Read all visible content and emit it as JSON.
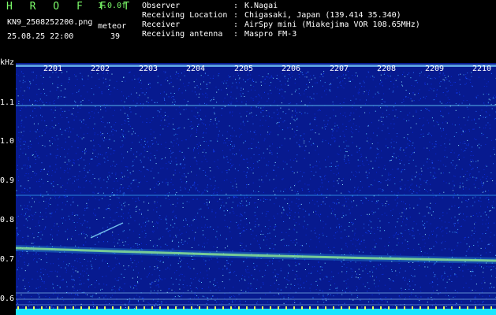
{
  "app": {
    "logo": "H R O F F T",
    "version": "1.0.0f",
    "filename": "KN9_2508252200.png",
    "meteo_label": "meteor",
    "datetime": "25.08.25 22:00",
    "count": "39"
  },
  "info": [
    {
      "key": "Observer",
      "value": "K.Nagai"
    },
    {
      "key": "Receiving Location",
      "value": "Chigasaki, Japan (139.414 35.340)"
    },
    {
      "key": "Receiver",
      "value": "AirSpy mini (Miakejima VOR 108.65MHz)"
    },
    {
      "key": "Receiving antenna",
      "value": "Maspro FM-3"
    }
  ],
  "axis": {
    "y_unit": "kHz",
    "y_ticks": [
      "1.1",
      "1.0",
      "0.9",
      "0.8",
      "0.7",
      "0.6"
    ],
    "time_ticks": [
      "2201",
      "2202",
      "2203",
      "2204",
      "2205",
      "2206",
      "2207",
      "2208",
      "2209",
      "2210"
    ]
  },
  "colors": {
    "accent": "#7CFC6A",
    "background": "#071a8f",
    "signal": "#b8ff6a",
    "baseline": "#18e6ff"
  }
}
